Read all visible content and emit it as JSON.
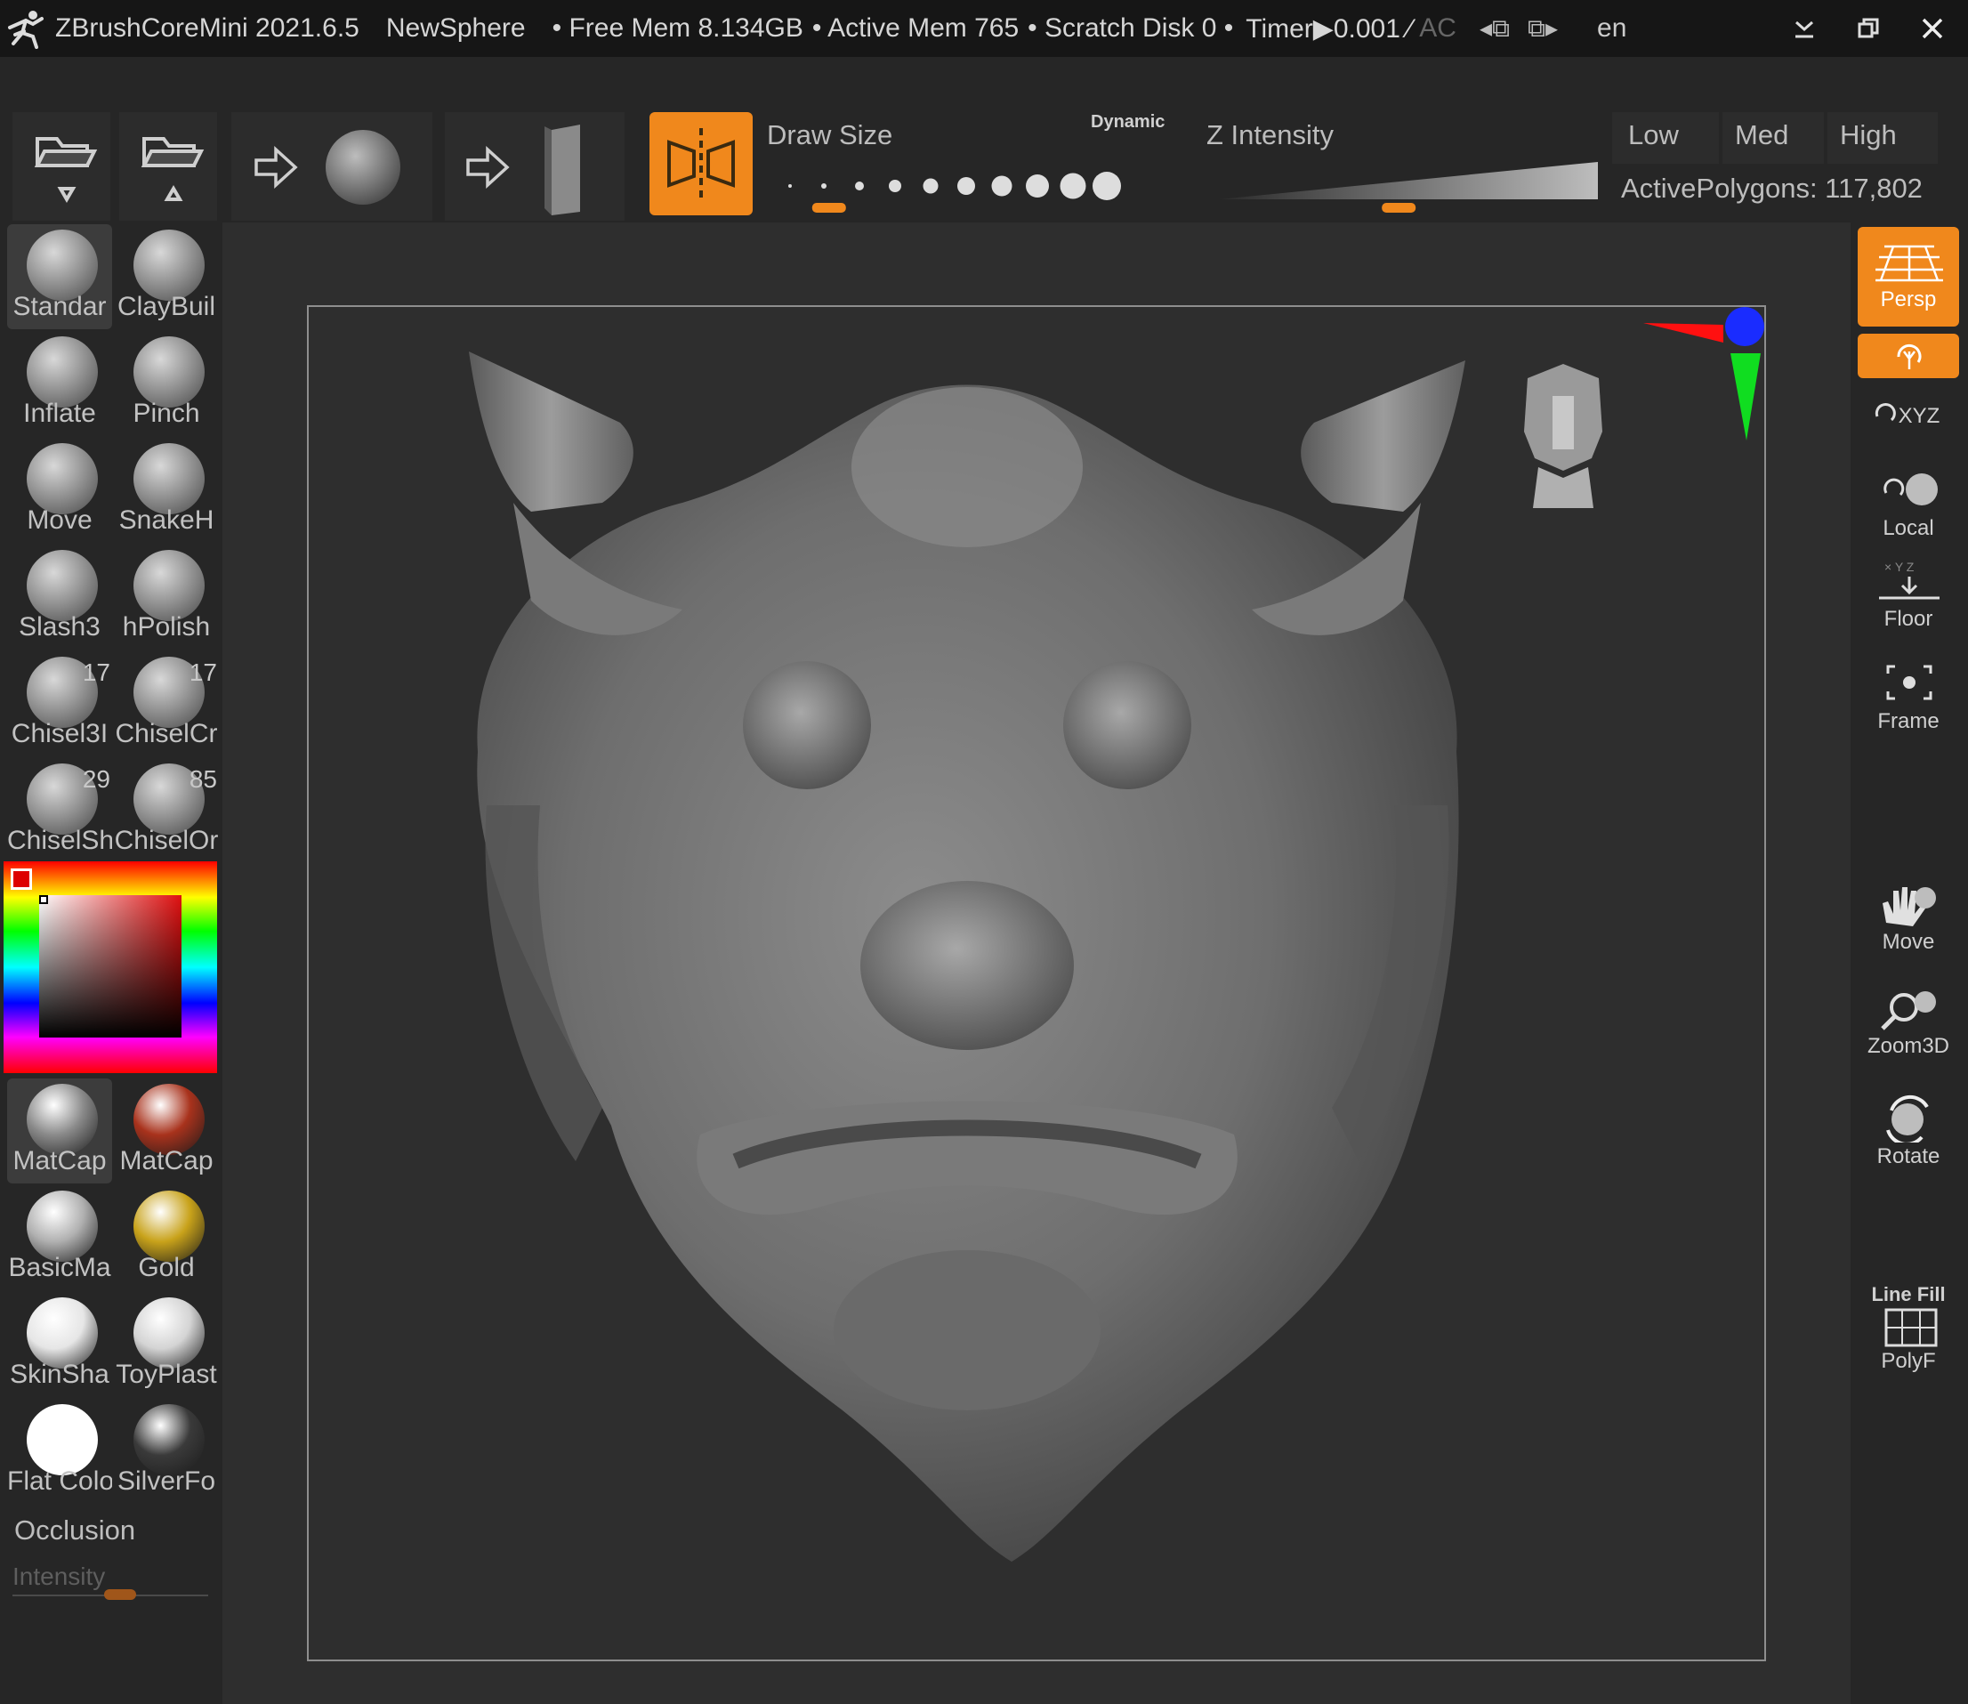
{
  "titlebar": {
    "app_title": "ZBrushCoreMini 2021.6.5",
    "document": "NewSphere",
    "free_mem": "• Free Mem 8.134GB",
    "active_mem": "• Active Mem 765",
    "scratch_disk": "• Scratch Disk 0 •",
    "timer": "Timer▶0.001 ⁄",
    "ac": "AC",
    "language": "en"
  },
  "shelf": {
    "draw_size_label": "Draw Size",
    "dynamic_label": "Dynamic",
    "z_intensity_label": "Z Intensity",
    "low": "Low",
    "med": "Med",
    "high": "High",
    "active_polygons": "ActivePolygons: 117,802",
    "draw_size_fraction": 0.06,
    "z_intensity_fraction": 0.43
  },
  "brushes": [
    {
      "name": "Standar",
      "icon": "standard-brush-icon"
    },
    {
      "name": "ClayBuil",
      "icon": "claybuildup-brush-icon"
    },
    {
      "name": "Inflate",
      "icon": "inflate-brush-icon"
    },
    {
      "name": "Pinch",
      "icon": "pinch-brush-icon"
    },
    {
      "name": "Move",
      "icon": "move-brush-icon"
    },
    {
      "name": "SnakeH",
      "icon": "snakehook-brush-icon"
    },
    {
      "name": "Slash3",
      "icon": "slash3-brush-icon"
    },
    {
      "name": "hPolish",
      "icon": "hpolish-brush-icon"
    },
    {
      "name": "Chisel3I",
      "icon": "chisel3d-brush-icon",
      "count": "17"
    },
    {
      "name": "ChiselCr",
      "icon": "chiselcreature-brush-icon",
      "count": "17"
    },
    {
      "name": "ChiselSh",
      "icon": "chiselshapes-brush-icon",
      "count": "29"
    },
    {
      "name": "ChiselOr",
      "icon": "chiselornament-brush-icon",
      "count": "85"
    }
  ],
  "materials": [
    {
      "name": "MatCap",
      "color": "#8a8a8a"
    },
    {
      "name": "MatCap",
      "color": "#a8321c"
    },
    {
      "name": "BasicMa",
      "color": "#b0b0b0"
    },
    {
      "name": "Gold",
      "color": "#c8a21a"
    },
    {
      "name": "SkinSha",
      "color": "#e6e6e6"
    },
    {
      "name": "ToyPlast",
      "color": "#d4d4d4"
    },
    {
      "name": "Flat Colo",
      "color": "#ffffff"
    },
    {
      "name": "SilverFo",
      "color": "#3a3a3a"
    }
  ],
  "occlusion": {
    "label": "Occlusion",
    "intensity_label": "Intensity",
    "intensity_fraction": 0.55
  },
  "right_panel": {
    "persp": "Persp",
    "xyz": "XYZ",
    "local": "Local",
    "floor": "Floor",
    "frame": "Frame",
    "move": "Move",
    "zoom3d": "Zoom3D",
    "rotate": "Rotate",
    "line_fill": "Line Fill",
    "polyf": "PolyF"
  },
  "colors": {
    "accent": "#f0881c",
    "panel": "#262626",
    "viewport": "#2e2e2e",
    "title_bar": "#161616"
  }
}
